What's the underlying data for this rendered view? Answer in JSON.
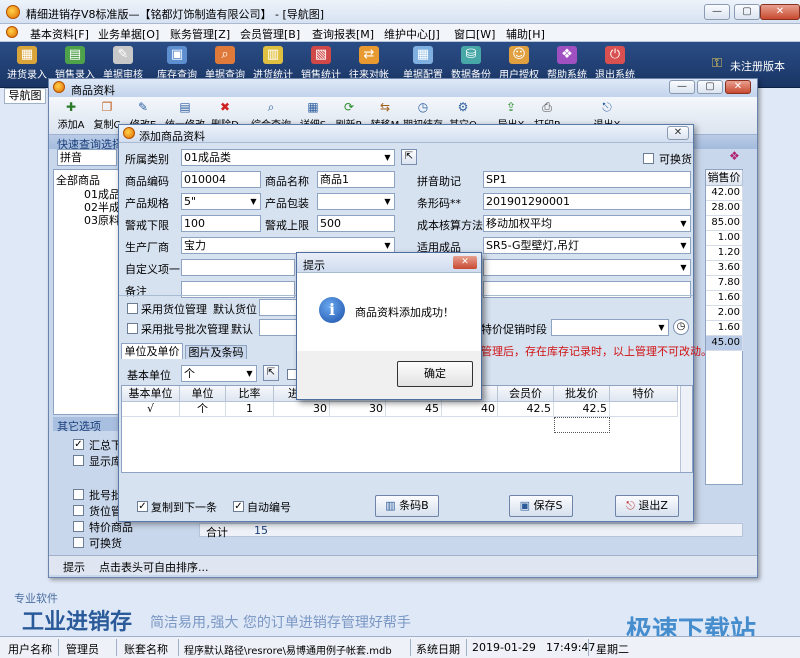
{
  "window": {
    "title": "精细进销存V8标准版—【铭都灯饰制造有限公司】 - [导航图]"
  },
  "menu": [
    "基本资料[F]",
    "业务单据[O]",
    "账务管理[Z]",
    "会员管理[B]",
    "查询报表[M]",
    "维护中心[J]",
    "窗口[W]",
    "辅助[H]"
  ],
  "toolbar": {
    "items": [
      "进货录入",
      "销售录入",
      "单据审核",
      "库存查询",
      "单据查询",
      "进货统计",
      "销售统计",
      "往来对帐",
      "单据配置",
      "数据备份",
      "用户授权",
      "帮助系统",
      "退出系统"
    ],
    "unregistered": "未注册版本"
  },
  "nav_tab": "导航图",
  "product_window": {
    "title": "商品资料",
    "tools": [
      "添加A",
      "复制C",
      "修改E",
      "统一修改",
      "删除D",
      "综合查询",
      "详细S",
      "刷新R",
      "转移M",
      "期初结存",
      "其它O",
      "导出X",
      "打印P",
      "退出X"
    ],
    "quick_query": "快速查询选择",
    "search_mode": "拼音",
    "tree": [
      "全部商品",
      "01成品",
      "02半成",
      "03原料"
    ],
    "other_options": "其它选项",
    "options": [
      "汇总下",
      "显示库"
    ],
    "options2": [
      "批号批",
      "货位管",
      "特价商品",
      "可换货"
    ],
    "right_col_header": "销售价",
    "right_col_values": [
      "42.00",
      "28.00",
      "85.00",
      "1.00",
      "1.20",
      "3.60",
      "7.80",
      "1.60",
      "2.00",
      "1.60",
      "45.00"
    ],
    "total_label": "合计",
    "total_count": "15",
    "hint_label": "提示",
    "hint_text": "点击表头可自由排序..."
  },
  "dialog": {
    "title": "添加商品资料",
    "fields": {
      "category_label": "所属类别",
      "category": "01成品类",
      "exchangeable": "可换货",
      "code_label": "商品编码",
      "code": "010004",
      "name_label": "商品名称",
      "name": "商品1",
      "pinyin_label": "拼音助记",
      "pinyin": "SP1",
      "spec_label": "产品规格",
      "spec": "5\"",
      "pack_label": "产品包装",
      "pack": "",
      "barcode_label": "条形码**",
      "barcode": "201901290001",
      "low_label": "警戒下限",
      "low": "100",
      "high_label": "警戒上限",
      "high": "500",
      "cost_label": "成本核算方法",
      "cost": "移动加权平均",
      "maker_label": "生产厂商",
      "maker": "宝力",
      "applicable_label": "适用成品",
      "applicable": "SR5-G型壁灯,吊灯",
      "custom_label": "自定义项一",
      "custom": "",
      "note_label": "备注",
      "note": ""
    },
    "loc_mgmt": "采用货位管理",
    "default_loc": "默认货位",
    "batch_mgmt": "采用批号批次管理",
    "default2": "默认",
    "promo_label": "特价促销时段",
    "warning": "管理后，存在库存记录时，以上管理不可改动。",
    "tabs": [
      "单位及单价",
      "图片及条码"
    ],
    "base_unit_label": "基本单位",
    "base_unit": "个",
    "grid_headers": [
      "基本单位",
      "单位",
      "比率",
      "进",
      "",
      "",
      "",
      "会员价",
      "批发价",
      "特价"
    ],
    "grid_row": [
      "√",
      "个",
      "1",
      "30",
      "30",
      "45",
      "40",
      "42.5",
      "42.5",
      ""
    ],
    "copy_next": "复制到下一条",
    "auto_number": "自动编号",
    "barcode_btn": "条码B",
    "save_btn": "保存S",
    "exit_btn": "退出Z"
  },
  "message": {
    "title": "提示",
    "text": "商品资料添加成功！",
    "ok": "确定"
  },
  "branding": {
    "logo": "工业进销存",
    "logo_small": "专业软件",
    "slogan": "简洁易用,强大 您的订单进销存管理好帮手",
    "watermark": "极速下载站"
  },
  "statusbar": {
    "user_label": "用户名称",
    "user": "管理员",
    "book_label": "账套名称",
    "book": "程序默认路径\\resrore\\易博通用例子帐套.mdb",
    "date_label": "系统日期",
    "date": "2019-01-29",
    "time": "17:49:47",
    "weekday": "星期二"
  }
}
